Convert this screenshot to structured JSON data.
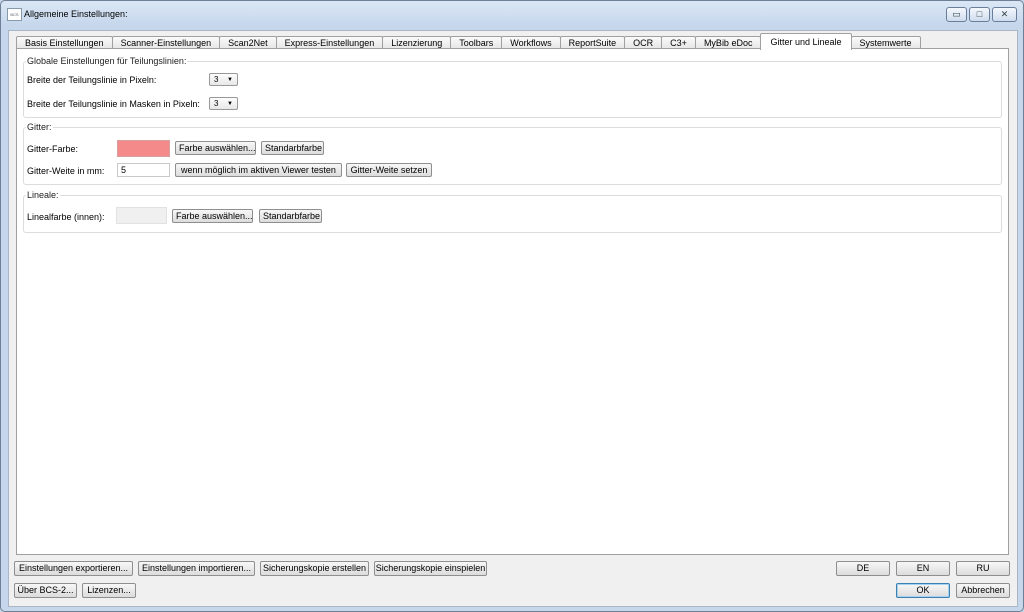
{
  "window": {
    "title": "Allgemeine Einstellungen:",
    "icon_label": "BCS",
    "controls": {
      "minimize": "▭",
      "maximize": "□",
      "close": "✕"
    }
  },
  "tabs": [
    "Basis Einstellungen",
    "Scanner-Einstellungen",
    "Scan2Net",
    "Express-Einstellungen",
    "Lizenzierung",
    "Toolbars",
    "Workflows",
    "ReportSuite",
    "OCR",
    "C3+",
    "MyBib eDoc",
    "Gitter und Lineale",
    "Systemwerte"
  ],
  "active_tab": "Gitter und Lineale",
  "teilungslinien": {
    "title": "Globale Einstellungen für Teilungslinien:",
    "breite_label": "Breite der Teilungslinie in Pixeln:",
    "breite_value": "3",
    "masken_label": "Breite der Teilungslinie in Masken in Pixeln:",
    "masken_value": "3"
  },
  "gitter": {
    "title": "Gitter:",
    "farbe_label": "Gitter-Farbe:",
    "farbe_color": "#f58a8a",
    "farbe_button": "Farbe auswählen...",
    "standard_button": "Standarbfarbe",
    "weite_label": "Gitter-Weite in mm:",
    "weite_value": "5",
    "test_button": "wenn möglich im aktiven Viewer testen",
    "set_button": "Gitter-Weite setzen"
  },
  "lineale": {
    "title": "Lineale:",
    "farbe_label": "Linealfarbe (innen):",
    "farbe_color": "#f0f0f0",
    "farbe_button": "Farbe auswählen...",
    "standard_button": "Standarbfarbe"
  },
  "footer": {
    "export": "Einstellungen exportieren...",
    "import": "Einstellungen importieren...",
    "backup_create": "Sicherungskopie erstellen",
    "backup_restore": "Sicherungskopie einspielen",
    "about": "Über BCS-2...",
    "licenses": "Lizenzen...",
    "lang_de": "DE",
    "lang_en": "EN",
    "lang_ru": "RU",
    "ok": "OK",
    "cancel": "Abbrechen"
  }
}
